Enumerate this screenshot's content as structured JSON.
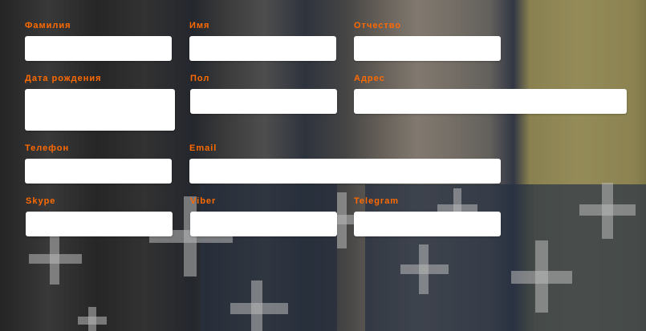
{
  "form": {
    "fields": [
      {
        "key": "surname",
        "label": "Фамилия",
        "value": "",
        "placeholder": ""
      },
      {
        "key": "name",
        "label": "Имя",
        "value": "",
        "placeholder": ""
      },
      {
        "key": "patronymic",
        "label": "Отчество",
        "value": "",
        "placeholder": ""
      },
      {
        "key": "birth_date",
        "label": "Дата рождения",
        "value": "",
        "placeholder": ""
      },
      {
        "key": "gender",
        "label": "Пол",
        "value": "",
        "placeholder": ""
      },
      {
        "key": "address",
        "label": "Адрес",
        "value": "",
        "placeholder": ""
      },
      {
        "key": "phone",
        "label": "Телефон",
        "value": "",
        "placeholder": ""
      },
      {
        "key": "email",
        "label": "Email",
        "value": "",
        "placeholder": ""
      },
      {
        "key": "skype",
        "label": "Skype",
        "value": "",
        "placeholder": ""
      },
      {
        "key": "viber",
        "label": "Viber",
        "value": "",
        "placeholder": ""
      },
      {
        "key": "telegram",
        "label": "Telegram",
        "value": "",
        "placeholder": ""
      }
    ]
  },
  "colors": {
    "label": "#ff6a00",
    "input_background": "#ffffff"
  },
  "background": {
    "icon": "plus-icon"
  }
}
